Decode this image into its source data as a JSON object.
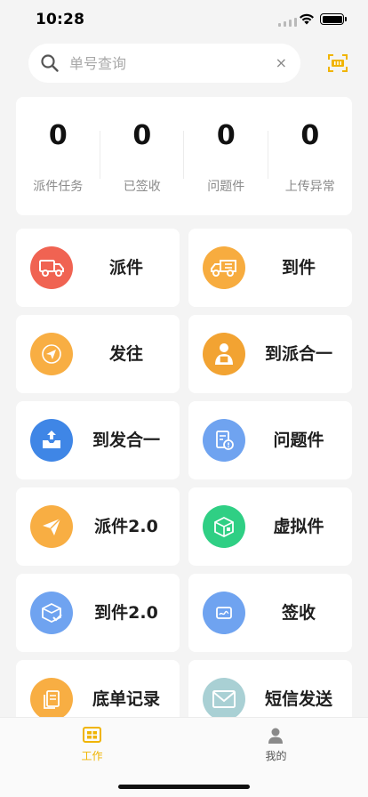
{
  "status_bar": {
    "time": "10:28"
  },
  "search": {
    "placeholder": "单号查询",
    "value": "",
    "clear_glyph": "×"
  },
  "stats": [
    {
      "value": "0",
      "label": "派件任务"
    },
    {
      "value": "0",
      "label": "已签收"
    },
    {
      "value": "0",
      "label": "问题件"
    },
    {
      "value": "0",
      "label": "上传异常"
    }
  ],
  "functions": [
    {
      "label": "派件",
      "icon": "delivery-truck-icon",
      "color": "#f06352"
    },
    {
      "label": "到件",
      "icon": "arrival-truck-icon",
      "color": "#f7ac3f"
    },
    {
      "label": "发往",
      "icon": "send-to-icon",
      "color": "#f8ae43"
    },
    {
      "label": "到派合一",
      "icon": "courier-package-icon",
      "color": "#f2a332"
    },
    {
      "label": "到发合一",
      "icon": "inbox-upload-icon",
      "color": "#3f86e6"
    },
    {
      "label": "问题件",
      "icon": "problem-document-icon",
      "color": "#6fa3f0"
    },
    {
      "label": "派件2.0",
      "icon": "paper-plane-icon",
      "color": "#f8ae43"
    },
    {
      "label": "虚拟件",
      "icon": "virtual-box-icon",
      "color": "#2fcf84"
    },
    {
      "label": "到件2.0",
      "icon": "box-check-icon",
      "color": "#6fa3f0"
    },
    {
      "label": "签收",
      "icon": "signature-icon",
      "color": "#6fa3f0"
    },
    {
      "label": "底单记录",
      "icon": "records-icon",
      "color": "#f8ae43"
    },
    {
      "label": "短信发送",
      "icon": "envelope-icon",
      "color": "#a9d0d4"
    }
  ],
  "tab_bar": {
    "tabs": [
      {
        "label": "工作",
        "icon": "workbench-icon",
        "active": true
      },
      {
        "label": "我的",
        "icon": "person-icon",
        "active": false
      }
    ],
    "active_color": "#f0b400",
    "inactive_color": "#555555"
  },
  "accent_color": "#f0b400"
}
